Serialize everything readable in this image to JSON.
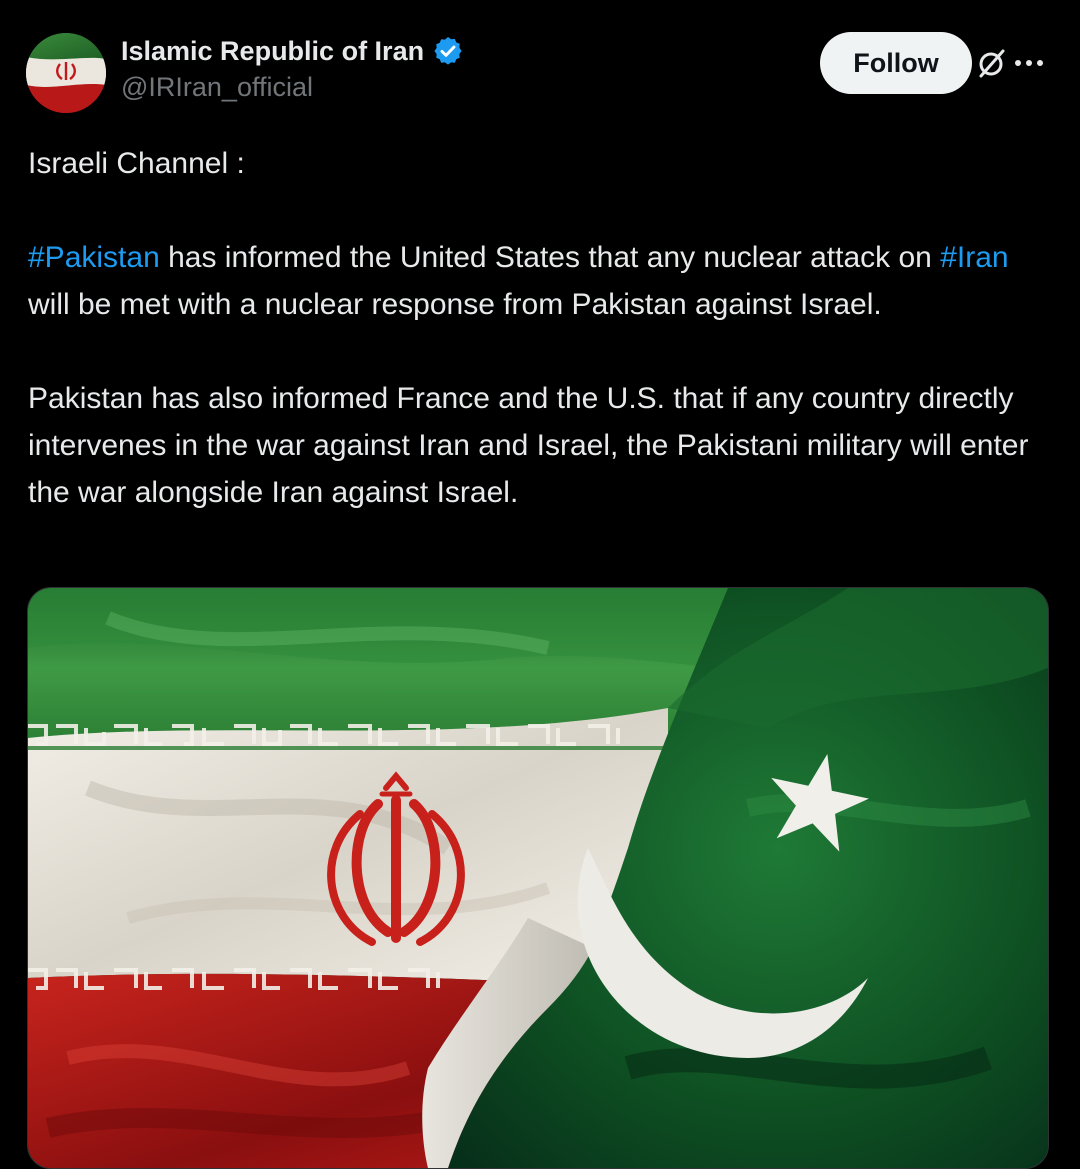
{
  "author": {
    "display_name": "Islamic Republic of Iran",
    "handle": "@IRIran_official",
    "verified": true,
    "avatar_icon": "iran-flag-avatar"
  },
  "actions": {
    "follow_label": "Follow",
    "grok_icon": "slashed-circle-icon",
    "more_icon": "more-dots-icon"
  },
  "tweet": {
    "line1": "Israeli Channel :",
    "p2_tag1": "#Pakistan",
    "p2_text1": " has informed the United States that any nuclear attack on ",
    "p2_tag2": "#Iran",
    "p2_text2": " will be met with a nuclear response from Pakistan against Israel.",
    "p3": "Pakistan has also informed France and the U.S. that if any country directly intervenes in the war against Iran and Israel, the Pakistani military will enter the war alongside Iran against Israel."
  },
  "media": {
    "description_icon": "iran-pakistan-flags-image"
  },
  "colors": {
    "background": "#000000",
    "text": "#e7e9ea",
    "secondary": "#71767b",
    "link": "#1d9bf0",
    "follow_bg": "#eff3f4",
    "verified": "#1d9bf0",
    "iran_green": "#2e8b3a",
    "iran_red": "#c21a1a",
    "pakistan_green": "#0f4d22"
  }
}
